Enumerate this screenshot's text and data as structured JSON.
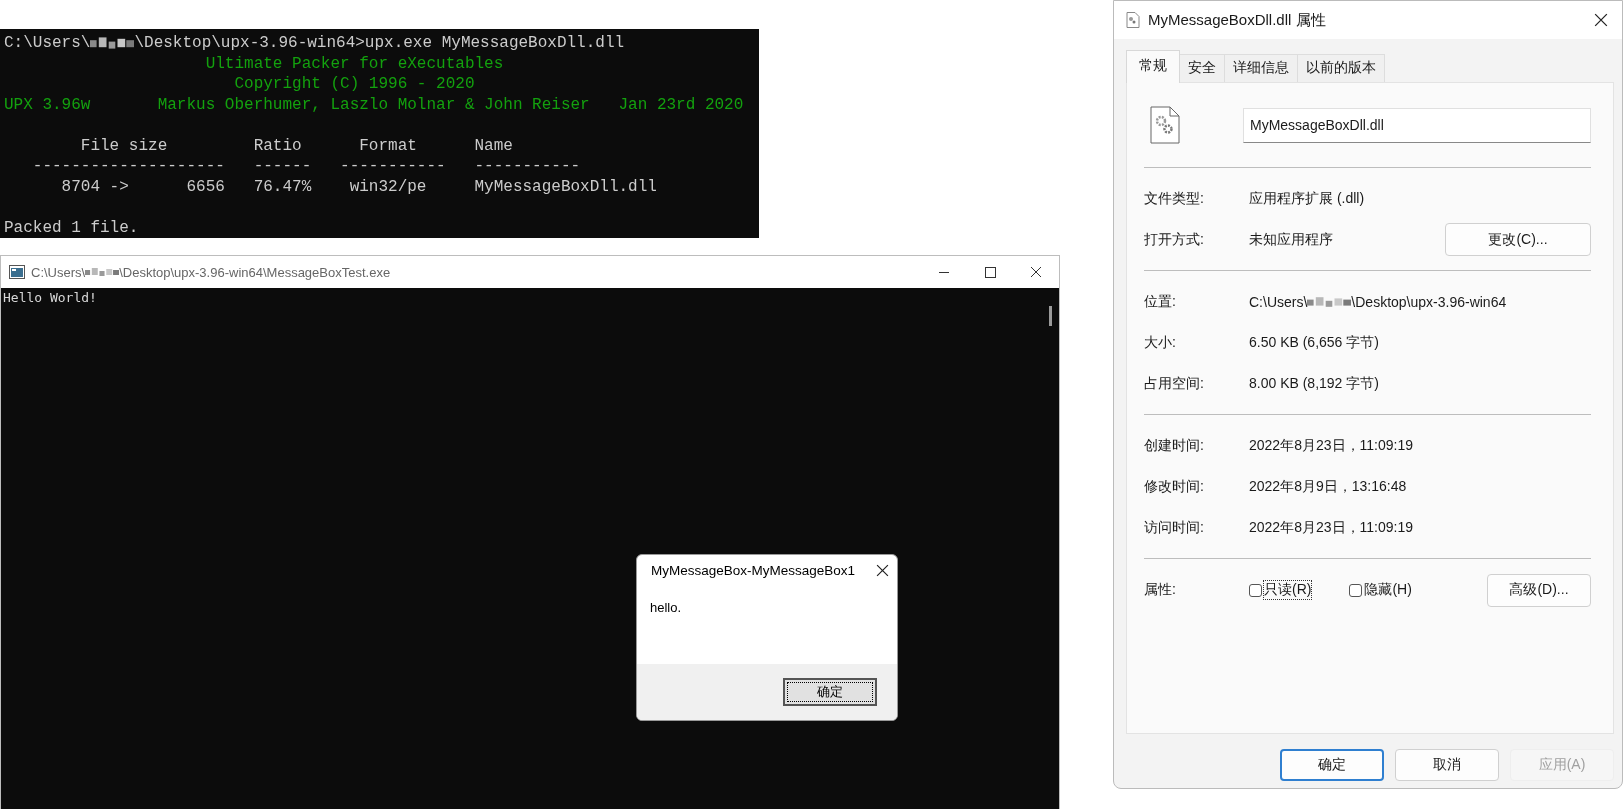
{
  "terminal": {
    "prompt_before": "C:\\Users\\",
    "prompt_after": "\\Desktop\\upx-3.96-win64>upx.exe MyMessageBoxDll.dll",
    "lines": [
      {
        "kind": "banner",
        "text": "                     Ultimate Packer for eXecutables"
      },
      {
        "kind": "banner",
        "text": "                        Copyright (C) 1996 - 2020"
      },
      {
        "kind": "banner",
        "text": "UPX 3.96w       Markus Oberhumer, Laszlo Molnar & John Reiser   Jan 23rd 2020"
      },
      {
        "kind": "blank"
      },
      {
        "kind": "output",
        "text": "        File size         Ratio      Format      Name"
      },
      {
        "kind": "output",
        "text": "   --------------------   ------   -----------   -----------"
      },
      {
        "kind": "output",
        "text": "      8704 ->      6656   76.47%    win32/pe     MyMessageBoxDll.dll"
      },
      {
        "kind": "blank"
      },
      {
        "kind": "output",
        "text": "Packed 1 file."
      }
    ]
  },
  "console": {
    "title_before": "C:\\Users\\",
    "title_after": "\\Desktop\\upx-3.96-win64\\MessageBoxTest.exe",
    "output": "Hello World!"
  },
  "message_box": {
    "title": "MyMessageBox-MyMessageBox1",
    "text": "hello.",
    "button": "确定"
  },
  "properties": {
    "title": "MyMessageBoxDll.dll 属性",
    "tabs": [
      {
        "label": "常规",
        "selected": true
      },
      {
        "label": "安全",
        "selected": false
      },
      {
        "label": "详细信息",
        "selected": false
      },
      {
        "label": "以前的版本",
        "selected": false
      }
    ],
    "file_name": "MyMessageBoxDll.dll",
    "sections": [
      [
        {
          "label": "文件类型:",
          "value": "应用程序扩展 (.dll)"
        },
        {
          "label": "打开方式:",
          "value": "未知应用程序",
          "button": "更改(C)..."
        }
      ],
      [
        {
          "label": "位置:",
          "value_before": "C:\\Users\\",
          "value": "\\Desktop\\upx-3.96-win64"
        },
        {
          "label": "大小:",
          "value": "6.50 KB (6,656 字节)"
        },
        {
          "label": "占用空间:",
          "value": "8.00 KB (8,192 字节)"
        }
      ],
      [
        {
          "label": "创建时间:",
          "value": "2022年8月23日，11:09:19"
        },
        {
          "label": "修改时间:",
          "value": "2022年8月9日，13:16:48"
        },
        {
          "label": "访问时间:",
          "value": "2022年8月23日，11:09:19"
        }
      ]
    ],
    "attributes": {
      "label": "属性:",
      "checkboxes": [
        {
          "label": "只读(R)",
          "checked": false,
          "focused": true
        },
        {
          "label": "隐藏(H)",
          "checked": false,
          "focused": false
        }
      ],
      "button": "高级(D)..."
    },
    "buttons": [
      {
        "label": "确定",
        "default": true,
        "disabled": false
      },
      {
        "label": "取消",
        "default": false,
        "disabled": false
      },
      {
        "label": "应用(A)",
        "default": false,
        "disabled": true
      }
    ]
  }
}
